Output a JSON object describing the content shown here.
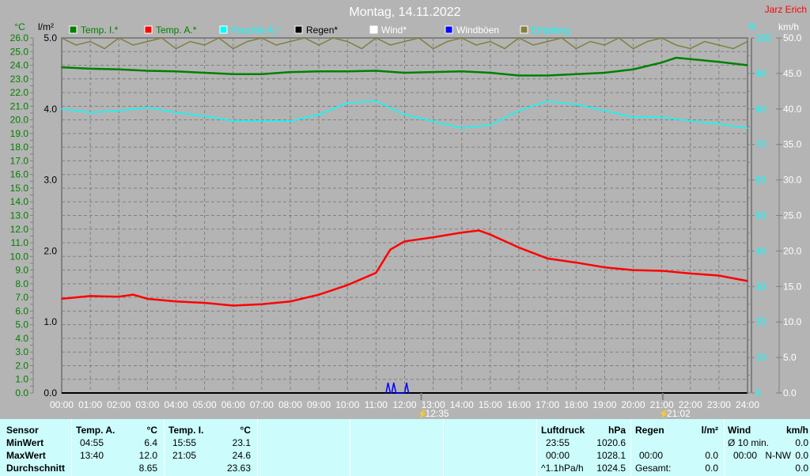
{
  "title": "Montag, 14.11.2022",
  "author": "Jarz Erich",
  "legend": [
    {
      "label": "Temp. I.*",
      "color": "#008000",
      "text_color": "#008000"
    },
    {
      "label": "Temp. A.*",
      "color": "#ff0000",
      "text_color": "#008000"
    },
    {
      "label": "Feuchte A.*",
      "color": "#00ffff",
      "text_color": "#00ffff"
    },
    {
      "label": "Regen*",
      "color": "#000000",
      "text_color": "#000000"
    },
    {
      "label": "Wind*",
      "color": "#ffffff",
      "text_color": "#ffffff"
    },
    {
      "label": "Windböen",
      "color": "#0000ff",
      "text_color": "#ffffff"
    },
    {
      "label": "Empfang",
      "color": "#808040",
      "text_color": "#00ffff"
    }
  ],
  "chart_data": {
    "type": "line",
    "title": "Montag, 14.11.2022",
    "x_ticks": [
      "00:00",
      "01:00",
      "02:00",
      "03:00",
      "04:00",
      "05:00",
      "06:00",
      "07:00",
      "08:00",
      "09:00",
      "10:00",
      "11:00",
      "12:00",
      "13:00",
      "14:00",
      "15:00",
      "16:00",
      "17:00",
      "18:00",
      "19:00",
      "20:00",
      "21:00",
      "22:00",
      "23:00",
      "24:00"
    ],
    "axes": {
      "temp": {
        "unit": "°C",
        "range": [
          0,
          26
        ]
      },
      "rain": {
        "unit": "l/m²",
        "range": [
          0,
          5
        ],
        "ticks": [
          "0.0",
          "1.0",
          "2.0",
          "3.0",
          "4.0",
          "5.0"
        ]
      },
      "humidity": {
        "unit": "%",
        "range": [
          0,
          100
        ],
        "ticks": [
          "0",
          "10",
          "20",
          "30",
          "40",
          "50",
          "60",
          "70",
          "80",
          "90",
          "100"
        ]
      },
      "wind": {
        "unit": "km/h",
        "range": [
          0,
          50
        ],
        "ticks": [
          "0.0",
          "5.0",
          "10.0",
          "15.0",
          "20.0",
          "25.0",
          "30.0",
          "35.0",
          "40.0",
          "45.0",
          "50.0"
        ]
      }
    },
    "grid": true,
    "series": [
      {
        "name": "Temp. A.*",
        "axis": "temp",
        "color": "#ff0000",
        "x": [
          0,
          1,
          2,
          2.5,
          3,
          4,
          5,
          6,
          7,
          8,
          9,
          10,
          11,
          11.5,
          12,
          13,
          14,
          14.6,
          15,
          16,
          17,
          18,
          19,
          20,
          21,
          22,
          23,
          24
        ],
        "y": [
          6.9,
          7.1,
          7.05,
          7.2,
          6.9,
          6.7,
          6.6,
          6.4,
          6.5,
          6.7,
          7.2,
          7.9,
          8.8,
          10.5,
          11.1,
          11.4,
          11.75,
          11.9,
          11.6,
          10.65,
          9.85,
          9.55,
          9.2,
          9.0,
          8.95,
          8.75,
          8.6,
          8.2
        ]
      },
      {
        "name": "Temp. I.*",
        "axis": "temp",
        "color": "#008000",
        "x": [
          0,
          1,
          2,
          3,
          4,
          5,
          6,
          7,
          8,
          9,
          10,
          11,
          12,
          13,
          14,
          15,
          16,
          17,
          18,
          19,
          20,
          21,
          21.5,
          22,
          23,
          24
        ],
        "y": [
          23.85,
          23.75,
          23.7,
          23.6,
          23.55,
          23.45,
          23.35,
          23.35,
          23.5,
          23.55,
          23.55,
          23.6,
          23.45,
          23.5,
          23.55,
          23.45,
          23.25,
          23.25,
          23.35,
          23.45,
          23.7,
          24.2,
          24.55,
          24.45,
          24.25,
          24.0
        ]
      },
      {
        "name": "Feuchte A.*",
        "axis": "humidity",
        "color": "#00ffff",
        "x": [
          0,
          1,
          2,
          3,
          4,
          5,
          6,
          7,
          8,
          9,
          10,
          11,
          12,
          13,
          14,
          15,
          16,
          17,
          18,
          19,
          20,
          21,
          22,
          23,
          24
        ],
        "y": [
          80,
          79,
          79.5,
          80.4,
          79,
          78,
          76.6,
          76.6,
          76.6,
          78.4,
          81.7,
          82.2,
          78.4,
          76.5,
          74.6,
          75.5,
          79.5,
          82.2,
          81.3,
          79.5,
          77.7,
          77.7,
          76.6,
          75.8,
          74.6
        ]
      },
      {
        "name": "Windböen",
        "axis": "wind",
        "color": "#0000ff",
        "x": [
          11.35,
          11.42,
          11.5,
          11.55,
          11.62,
          11.7,
          12.0,
          12.07,
          12.14
        ],
        "y": [
          0,
          1.4,
          0,
          0,
          1.4,
          0,
          0,
          1.4,
          0
        ]
      },
      {
        "name": "Empfang",
        "axis": "humidity",
        "color": "#808040",
        "x": [
          0,
          0.5,
          1,
          1.5,
          2,
          2.5,
          3,
          3.5,
          4,
          4.5,
          5,
          5.5,
          6,
          6.5,
          7,
          7.5,
          8,
          8.5,
          9,
          9.5,
          10,
          10.5,
          11,
          11.5,
          12,
          12.5,
          13,
          13.5,
          14,
          14.5,
          15,
          15.5,
          16,
          16.5,
          17,
          17.5,
          18,
          18.5,
          19,
          19.5,
          20,
          20.5,
          21,
          21.5,
          22,
          22.5,
          23,
          23.5,
          24
        ],
        "y": [
          100,
          98,
          99,
          97,
          100,
          98,
          99,
          100,
          97,
          99,
          98,
          100,
          97,
          99,
          100,
          98,
          99,
          100,
          98,
          100,
          99,
          97,
          100,
          98,
          99,
          100,
          97,
          99,
          100,
          98,
          99,
          97,
          100,
          98,
          99,
          100,
          97,
          99,
          98,
          100,
          97,
          99,
          100,
          98,
          97,
          99,
          98,
          97,
          99
        ]
      }
    ],
    "markers": [
      {
        "time": "12:35",
        "x": 12.583
      },
      {
        "time": "21:02",
        "x": 21.033
      }
    ]
  },
  "table": {
    "sensor": {
      "header": "Sensor",
      "rows": [
        "MinWert",
        "MaxWert",
        "Durchschnitt"
      ]
    },
    "temp_a": {
      "header": "Temp. A.",
      "unit": "°C",
      "min_time": "04:55",
      "min": "6.4",
      "max_time": "13:40",
      "max": "12.0",
      "avg": "8.65"
    },
    "temp_i": {
      "header": "Temp. I.",
      "unit": "°C",
      "min_time": "15:55",
      "min": "23.1",
      "max_time": "21:05",
      "max": "24.6",
      "avg": "23.63"
    },
    "pressure": {
      "header": "Luftdruck",
      "unit": "hPa",
      "min_time": "23:55",
      "min": "1020.6",
      "max_time": "00:00",
      "max": "1028.1",
      "trend": "^1.1hPa/h",
      "avg": "1024.5"
    },
    "rain": {
      "header": "Regen",
      "unit": "l/m²",
      "max_time": "00:00",
      "max": "0.0",
      "total_label": "Gesamt:",
      "total": "0.0"
    },
    "wind": {
      "header": "Wind",
      "unit": "km/h",
      "avg_label": "Ø 10 min.",
      "avg": "0.0",
      "max_time": "00:00",
      "max_dir": "N-NW",
      "max": "0.0",
      "total": "0.0"
    }
  }
}
